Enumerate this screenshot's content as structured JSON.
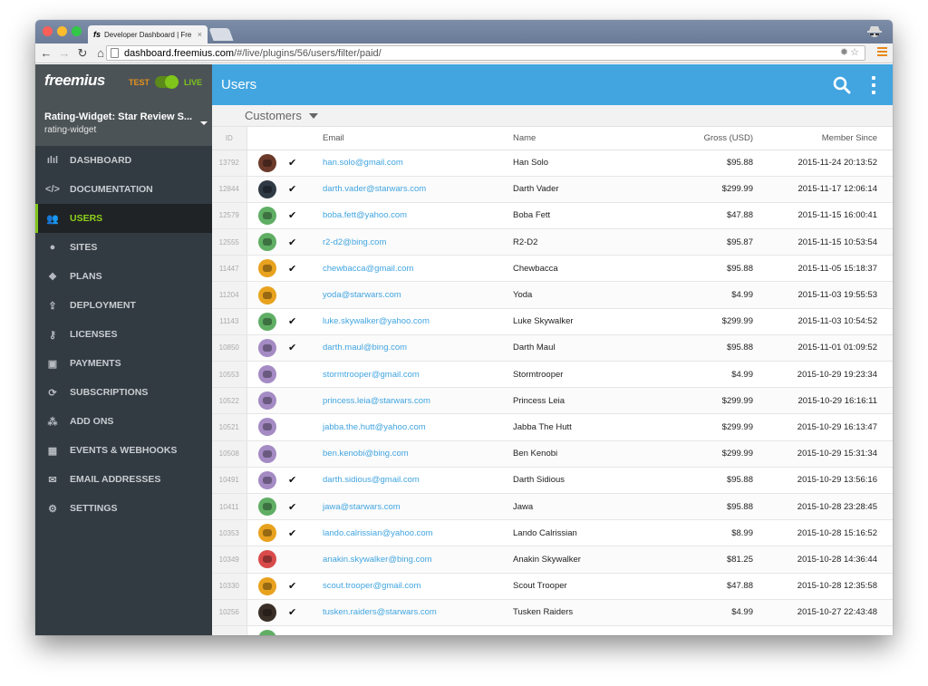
{
  "browser": {
    "tab_favicon": "fs",
    "tab_title": "Developer Dashboard | Fre",
    "tab_close": "×",
    "url_host": "dashboard.freemius.com",
    "url_path": "/#/live/plugins/56/users/filter/paid/",
    "url_right_icons": "✹☆"
  },
  "sidebar": {
    "logo": "freemius",
    "env_test": "TEST",
    "env_live": "LIVE",
    "env_mode": "live",
    "plugin_name": "Rating-Widget: Star Review S...",
    "plugin_slug": "rating-widget",
    "items": [
      {
        "label": "DASHBOARD",
        "icon": "bar-chart-icon",
        "glyph": "ılıl",
        "active": false
      },
      {
        "label": "DOCUMENTATION",
        "icon": "code-icon",
        "glyph": "</>",
        "active": false
      },
      {
        "label": "USERS",
        "icon": "users-icon",
        "glyph": "👥",
        "active": true
      },
      {
        "label": "SITES",
        "icon": "globe-icon",
        "glyph": "●",
        "active": false
      },
      {
        "label": "PLANS",
        "icon": "dropbox-icon",
        "glyph": "❖",
        "active": false
      },
      {
        "label": "DEPLOYMENT",
        "icon": "upload-icon",
        "glyph": "⇪",
        "active": false
      },
      {
        "label": "LICENSES",
        "icon": "key-icon",
        "glyph": "⚷",
        "active": false
      },
      {
        "label": "PAYMENTS",
        "icon": "money-icon",
        "glyph": "▣",
        "active": false
      },
      {
        "label": "SUBSCRIPTIONS",
        "icon": "refresh-icon",
        "glyph": "⟳",
        "active": false
      },
      {
        "label": "ADD ONS",
        "icon": "cubes-icon",
        "glyph": "⁂",
        "active": false
      },
      {
        "label": "EVENTS & WEBHOOKS",
        "icon": "calendar-icon",
        "glyph": "▦",
        "active": false
      },
      {
        "label": "EMAIL ADDRESSES",
        "icon": "envelope-icon",
        "glyph": "✉",
        "active": false
      },
      {
        "label": "SETTINGS",
        "icon": "gear-icon",
        "glyph": "⚙",
        "active": false
      }
    ]
  },
  "header": {
    "title": "Users"
  },
  "filter": {
    "label": "Customers"
  },
  "table": {
    "columns": {
      "id": "ID",
      "email": "Email",
      "name": "Name",
      "gross": "Gross (USD)",
      "since": "Member Since"
    },
    "rows": [
      {
        "id": "13792",
        "avatar_color": "#6b3a2a",
        "paid": true,
        "email": "han.solo@gmail.com",
        "name": "Han Solo",
        "gross": "$95.88",
        "since": "2015-11-24 20:13:52"
      },
      {
        "id": "12844",
        "avatar_color": "#2f3a45",
        "paid": true,
        "email": "darth.vader@starwars.com",
        "name": "Darth Vader",
        "gross": "$299.99",
        "since": "2015-11-17 12:06:14"
      },
      {
        "id": "12579",
        "avatar_color": "#5fae64",
        "paid": true,
        "email": "boba.fett@yahoo.com",
        "name": "Boba Fett",
        "gross": "$47.88",
        "since": "2015-11-15 16:00:41"
      },
      {
        "id": "12555",
        "avatar_color": "#5fae64",
        "paid": true,
        "email": "r2-d2@bing.com",
        "name": "R2-D2",
        "gross": "$95.87",
        "since": "2015-11-15 10:53:54"
      },
      {
        "id": "11447",
        "avatar_color": "#e8a21e",
        "paid": true,
        "email": "chewbacca@gmail.com",
        "name": "Chewbacca",
        "gross": "$95.88",
        "since": "2015-11-05 15:18:37"
      },
      {
        "id": "11204",
        "avatar_color": "#e8a21e",
        "paid": false,
        "email": "yoda@starwars.com",
        "name": "Yoda",
        "gross": "$4.99",
        "since": "2015-11-03 19:55:53"
      },
      {
        "id": "11143",
        "avatar_color": "#5fae64",
        "paid": true,
        "email": "luke.skywalker@yahoo.com",
        "name": "Luke Skywalker",
        "gross": "$299.99",
        "since": "2015-11-03 10:54:52"
      },
      {
        "id": "10850",
        "avatar_color": "#a48bc4",
        "paid": true,
        "email": "darth.maul@bing.com",
        "name": "Darth Maul",
        "gross": "$95.88",
        "since": "2015-11-01 01:09:52"
      },
      {
        "id": "10553",
        "avatar_color": "#a48bc4",
        "paid": false,
        "email": "stormtrooper@gmail.com",
        "name": "Stormtrooper",
        "gross": "$4.99",
        "since": "2015-10-29 19:23:34"
      },
      {
        "id": "10522",
        "avatar_color": "#a48bc4",
        "paid": false,
        "email": "princess.leia@starwars.com",
        "name": "Princess Leia",
        "gross": "$299.99",
        "since": "2015-10-29 16:16:11"
      },
      {
        "id": "10521",
        "avatar_color": "#a48bc4",
        "paid": false,
        "email": "jabba.the.hutt@yahoo.com",
        "name": "Jabba The Hutt",
        "gross": "$299.99",
        "since": "2015-10-29 16:13:47"
      },
      {
        "id": "10508",
        "avatar_color": "#a48bc4",
        "paid": false,
        "email": "ben.kenobi@bing.com",
        "name": "Ben Kenobi",
        "gross": "$299.99",
        "since": "2015-10-29 15:31:34"
      },
      {
        "id": "10491",
        "avatar_color": "#a48bc4",
        "paid": true,
        "email": "darth.sidious@gmail.com",
        "name": "Darth Sidious",
        "gross": "$95.88",
        "since": "2015-10-29 13:56:16"
      },
      {
        "id": "10411",
        "avatar_color": "#5fae64",
        "paid": true,
        "email": "jawa@starwars.com",
        "name": "Jawa",
        "gross": "$95.88",
        "since": "2015-10-28 23:28:45"
      },
      {
        "id": "10353",
        "avatar_color": "#e8a21e",
        "paid": true,
        "email": "lando.calrissian@yahoo.com",
        "name": "Lando Calrissian",
        "gross": "$8.99",
        "since": "2015-10-28 15:16:52"
      },
      {
        "id": "10349",
        "avatar_color": "#d94a4a",
        "paid": false,
        "email": "anakin.skywalker@bing.com",
        "name": "Anakin Skywalker",
        "gross": "$81.25",
        "since": "2015-10-28 14:36:44"
      },
      {
        "id": "10330",
        "avatar_color": "#e8a21e",
        "paid": true,
        "email": "scout.trooper@gmail.com",
        "name": "Scout Trooper",
        "gross": "$47.88",
        "since": "2015-10-28 12:35:58"
      },
      {
        "id": "10256",
        "avatar_color": "#3a2f28",
        "paid": true,
        "email": "tusken.raiders@starwars.com",
        "name": "Tusken Raiders",
        "gross": "$4.99",
        "since": "2015-10-27 22:43:48"
      },
      {
        "id": "",
        "avatar_color": "#5fae64",
        "paid": false,
        "email": "",
        "name": "",
        "gross": "",
        "since": ""
      }
    ]
  },
  "colors": {
    "header_blue": "#42a5e0",
    "sidebar_bg": "#333b42",
    "active_green": "#7fc51b",
    "test_orange": "#e5921b",
    "link_blue": "#42a5e0"
  }
}
